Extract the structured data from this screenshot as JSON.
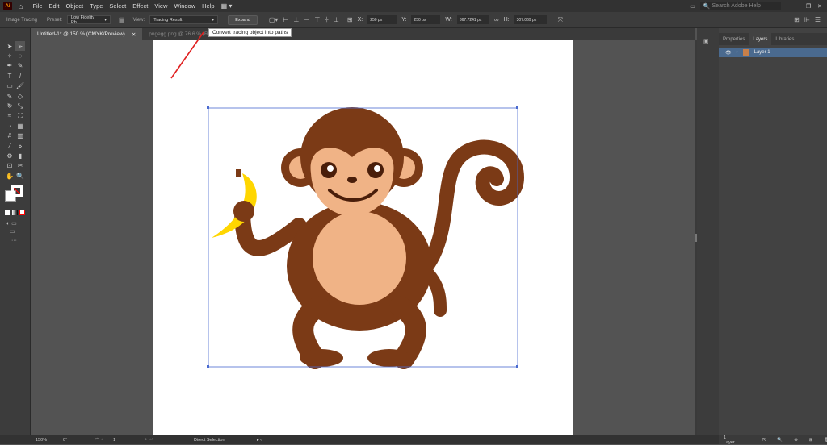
{
  "app": {
    "logo": "Ai"
  },
  "menu": [
    "File",
    "Edit",
    "Object",
    "Type",
    "Select",
    "Effect",
    "View",
    "Window",
    "Help"
  ],
  "search_placeholder": "Search Adobe Help",
  "control": {
    "panel_label": "Image Tracing",
    "preset_label": "Preset:",
    "preset_value": "Low Fidelity Ph...",
    "view_label": "View:",
    "view_value": "Tracing Result",
    "expand": "Expand",
    "x_label": "X:",
    "x": "250 px",
    "y_label": "Y:",
    "y": "250 px",
    "w_label": "W:",
    "w": "367.7241 px",
    "h_label": "H:",
    "h": "307.069 px"
  },
  "tooltip": "Convert tracing object into paths",
  "tabs": [
    {
      "label": "Untitled-1* @ 150 % (CMYK/Preview)"
    },
    {
      "label": "pngegg.png @ 76.6 % (RGB/Preview)"
    }
  ],
  "panel": {
    "tabs": [
      "Properties",
      "Layers",
      "Libraries"
    ],
    "layer": "Layer 1",
    "footer": "1 Layer"
  },
  "status": {
    "zoom": "150%",
    "rotation": "0°",
    "artboard": "1",
    "tool": "Direct Selection"
  },
  "colors": {
    "accent": "#4a6a8f",
    "fur": "#7b3a16",
    "face": "#f0b386",
    "banana": "#ffd600"
  }
}
